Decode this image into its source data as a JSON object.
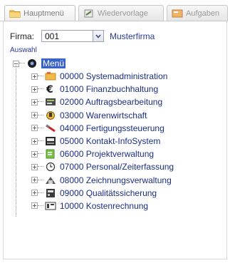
{
  "tabs": [
    {
      "label": "Hauptmenü",
      "icon": "folder-icon",
      "active": true
    },
    {
      "label": "Wiedervorlage",
      "icon": "resubmission-icon",
      "active": false
    },
    {
      "label": "Aufgaben",
      "icon": "tasks-icon",
      "active": false
    }
  ],
  "firma": {
    "label": "Firma:",
    "value": "001",
    "name": "Musterfirma"
  },
  "auswahl": "Auswahl",
  "tree": {
    "root": {
      "label": "Menü",
      "icon": "menu-root-icon",
      "expanded": true
    },
    "items": [
      {
        "label": "00000 Systemadministration",
        "icon": "system-admin-icon"
      },
      {
        "label": "01000 Finanzbuchhaltung",
        "icon": "euro-icon"
      },
      {
        "label": "02000 Auftragsbearbeitung",
        "icon": "order-icon"
      },
      {
        "label": "03000 Warenwirtschaft",
        "icon": "goods-icon"
      },
      {
        "label": "04000 Fertigungssteuerung",
        "icon": "production-icon"
      },
      {
        "label": "05000 Kontakt-InfoSystem",
        "icon": "contact-icon"
      },
      {
        "label": "06000 Projektverwaltung",
        "icon": "project-icon"
      },
      {
        "label": "07000 Personal/Zeiterfassung",
        "icon": "clock-icon"
      },
      {
        "label": "08000 Zeichnungsverwaltung",
        "icon": "drawing-icon"
      },
      {
        "label": "09000 Qualitätssicherung",
        "icon": "quality-icon"
      },
      {
        "label": "10000 Kostenrechnung",
        "icon": "cost-icon"
      }
    ]
  },
  "colors": {
    "link": "#2a3a9a",
    "tree_text": "#1a2e86",
    "selection": "#3a63c9"
  }
}
